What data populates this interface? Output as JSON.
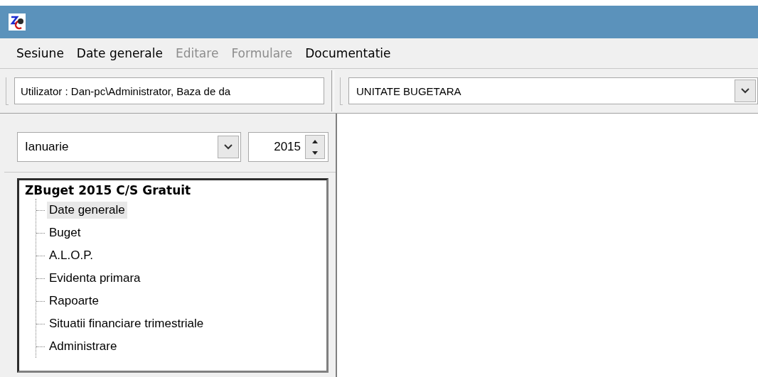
{
  "menu": [
    {
      "label": "Sesiune",
      "disabled": false
    },
    {
      "label": "Date generale",
      "disabled": false
    },
    {
      "label": "Editare",
      "disabled": true
    },
    {
      "label": "Formulare",
      "disabled": true
    },
    {
      "label": "Documentatie",
      "disabled": false
    }
  ],
  "toolbar": {
    "user_field": {
      "value": "Utilizator : Dan-pc\\Administrator, Baza de da"
    },
    "unit_select": {
      "value": "UNITATE BUGETARA"
    }
  },
  "period": {
    "month": {
      "value": "Ianuarie"
    },
    "year": {
      "value": "2015"
    }
  },
  "tree": {
    "label": "ZBuget 2015 C/S Gratuit",
    "children": [
      {
        "label": "Date generale",
        "selected": true
      },
      {
        "label": "Buget",
        "selected": false
      },
      {
        "label": "A.L.O.P.",
        "selected": false
      },
      {
        "label": "Evidenta primara",
        "selected": false
      },
      {
        "label": "Rapoarte",
        "selected": false
      },
      {
        "label": "Situatii financiare trimestriale",
        "selected": false
      },
      {
        "label": "Administrare",
        "selected": false
      }
    ]
  }
}
